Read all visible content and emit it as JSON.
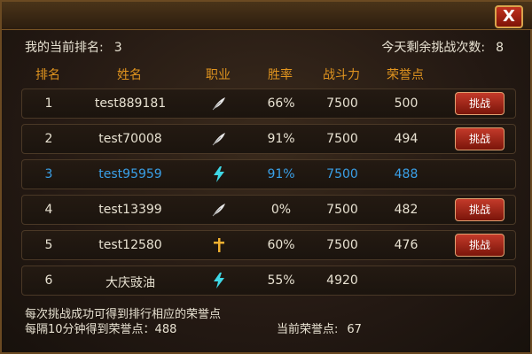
{
  "window": {
    "close_label": "X"
  },
  "summary": {
    "my_rank_label": "我的当前排名:",
    "my_rank_value": "3",
    "remaining_label": "今天剩余挑战次数:",
    "remaining_value": "8"
  },
  "columns": [
    "排名",
    "姓名",
    "职业",
    "胜率",
    "战斗力",
    "荣誉点"
  ],
  "rows": [
    {
      "rank": "1",
      "name": "test889181",
      "job_icon": "feather-icon",
      "win_rate": "66%",
      "power": "7500",
      "honor": "500",
      "button": "挑战"
    },
    {
      "rank": "2",
      "name": "test70008",
      "job_icon": "feather-icon",
      "win_rate": "91%",
      "power": "7500",
      "honor": "494",
      "button": "挑战"
    },
    {
      "rank": "3",
      "name": "test95959",
      "job_icon": "lightning-icon",
      "win_rate": "91%",
      "power": "7500",
      "honor": "488",
      "button": ""
    },
    {
      "rank": "4",
      "name": "test13399",
      "job_icon": "feather-icon",
      "win_rate": "0%",
      "power": "7500",
      "honor": "482",
      "button": "挑战"
    },
    {
      "rank": "5",
      "name": "test12580",
      "job_icon": "cross-icon",
      "win_rate": "60%",
      "power": "7500",
      "honor": "476",
      "button": "挑战"
    },
    {
      "rank": "6",
      "name": "大庆豉油",
      "job_icon": "lightning-icon",
      "win_rate": "55%",
      "power": "4920",
      "honor": "",
      "button": ""
    }
  ],
  "footer": {
    "line1": "每次挑战成功可得到排行相应的荣誉点",
    "line2": "每隔10分钟得到荣誉点：488",
    "current_honor_label": "当前荣誉点:",
    "current_honor_value": "67"
  },
  "colors": {
    "header_text": "#e0941f",
    "self_row_text": "#3aa0e8",
    "button_red": "#c43a2a"
  }
}
